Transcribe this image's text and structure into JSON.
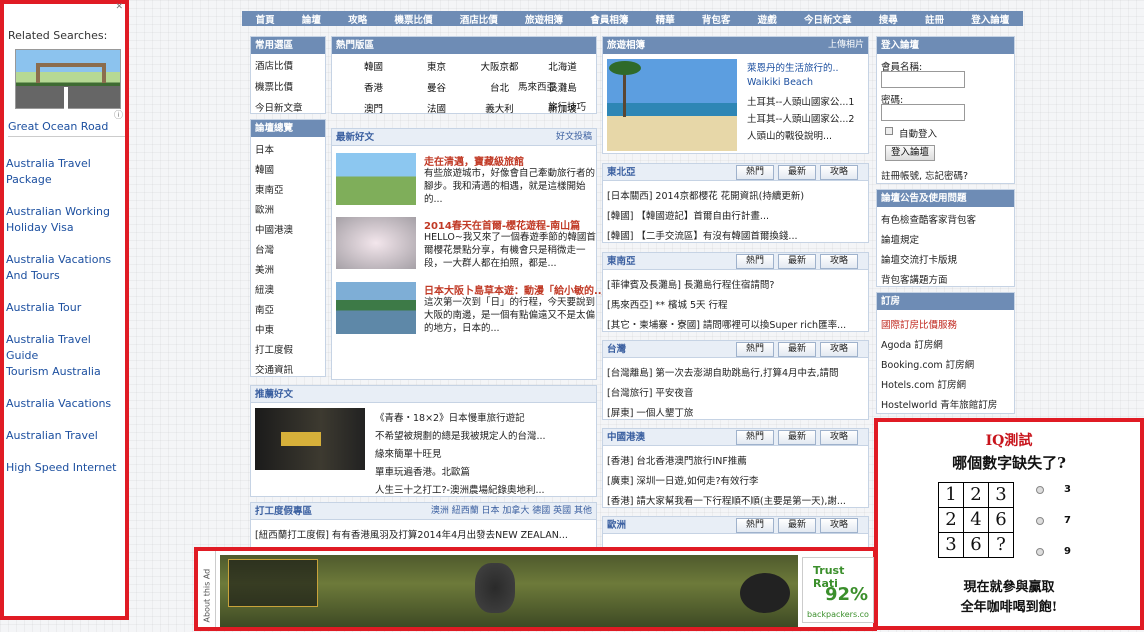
{
  "sidebar": {
    "related": "Related Searches:",
    "caption": "Great Ocean Road",
    "links": [
      "Australia Travel Package",
      "Australian Working Holiday Visa",
      "Australia Vacations And Tours",
      "Australia Tour",
      "Australia Travel Guide",
      "Tourism Australia",
      "Australia Vacations",
      "Australian Travel",
      "High Speed Internet"
    ]
  },
  "nav": [
    "首頁",
    "論壇",
    "攻略",
    "機票比價",
    "酒店比價",
    "旅遊相簿",
    "會員相簿",
    "精華",
    "背包客",
    "遊戲",
    "今日新文章",
    "搜尋",
    "註冊",
    "登入論壇"
  ],
  "common": {
    "title": "常用選區",
    "items": [
      "酒店比價",
      "機票比價",
      "今日新文章"
    ]
  },
  "hot": {
    "title": "熱門版區",
    "items": [
      "韓國",
      "東京",
      "大阪京都",
      "北海道",
      "香港",
      "曼谷",
      "台北",
      "長灘島",
      "澳門",
      "法國",
      "義大利",
      "新加坡",
      "馬來西亞",
      "旅行技巧"
    ]
  },
  "album": {
    "title": "旅遊相簿",
    "more": "上傳相片",
    "caption": "Waikiki Beach",
    "items": [
      "萊恩丹的生活旅行的..",
      "土耳其--人頭山國家公...1",
      "土耳其--人頭山國家公...2",
      "人頭山的戰役說明..."
    ]
  },
  "login": {
    "title": "登入論壇",
    "user_label": "會員名稱:",
    "pass_label": "密碼:",
    "remember": "自動登入",
    "button": "登入論壇",
    "forgot": "註冊帳號, 忘記密碼?"
  },
  "forum": {
    "title": "論壇總覽",
    "items": [
      "日本",
      "韓國",
      "東南亞",
      "歐洲",
      "中國港澳",
      "台灣",
      "美洲",
      "紐澳",
      "南亞",
      "中東",
      "打工度假",
      "旅遊技巧",
      "交通資訊",
      "更多論壇"
    ]
  },
  "latest": {
    "title": "最新好文",
    "more": "好文投稿",
    "articles": [
      {
        "title": "走在清邁，寶藏級旅館",
        "body": "有些旅遊城市，好像會自己牽動旅行者的腳步。我和清邁的相遇，就是這樣開始的..."
      },
      {
        "title": "2014春天在首爾-櫻花遊程-南山篇",
        "body": "HELLO~我又來了一個春遊季節的韓國首爾櫻花景點分享，有機會只是稍微走一段，一大群人都在拍照，都是..."
      },
      {
        "title": "日本大阪卜島草本遊：動漫「給小敏的..」",
        "body": "這次第一次到「日」的行程，今天要說到大阪的南邊，是一個有點偏遠又不是太偏的地方，日本的..."
      }
    ]
  },
  "recommend": {
    "title": "推薦好文",
    "items": [
      "《青春・18×2》日本慢車旅行遊記",
      "不希望被規劃的總是我被規定人的台灣...",
      "緣來簡單十旺見",
      "單車玩遍香港。北歐篇",
      "人生三十之打工?-澳洲農場紀錄奧地利..."
    ]
  },
  "work": {
    "title": "打工度假專區",
    "regions": "澳洲 紐西蘭 日本 加拿大 德國 英國 其他",
    "item": "[紐西蘭打工度假] 有有香港風羽及打算2014年4月出發去NEW ZEALAN..."
  },
  "tabs": [
    "熱門",
    "最新",
    "攻略"
  ],
  "regions": [
    {
      "title": "東北亞",
      "items": [
        "[日本關西] 2014京都櫻花 花開資訊(持續更新)",
        "[韓國] 【韓國遊記】首爾自由行計畫...",
        "[韓國] 【二手交流區】有沒有韓國首爾換錢..."
      ]
    },
    {
      "title": "東南亞",
      "items": [
        "[菲律賓及長灘島] 長灘島行程住宿請問?",
        "[馬來西亞] ** 檳城 5天 行程",
        "[其它・柬埔寨・寮國] 請問哪裡可以換Super rich匯率..."
      ]
    },
    {
      "title": "台灣",
      "items": [
        "[台灣離島] 第一次去澎湖自助跳島行,打算4月中去,請問",
        "[台灣旅行] 平安夜音",
        "[屏東] 一個人墾丁旅"
      ]
    },
    {
      "title": "中國港澳",
      "items": [
        "[香港] 台北香港澳門旅行INF推薦",
        "[廣東] 深圳一日遊,如何走?有效行李",
        "[香港] 請大家幫我看一下行程順不順(主要是第一天),謝..."
      ]
    },
    {
      "title": "歐洲",
      "items": [
        "[中歐東歐其他] 歐洲行程...找同伴..."
      ]
    }
  ],
  "news": {
    "title": "論壇公告及使用問題",
    "items": [
      "有色檢查酷客家背包客",
      "論壇規定",
      "論壇交流打卡版規",
      "背包客講題方面"
    ]
  },
  "hotel": {
    "title": "訂房",
    "items": [
      "國際訂房比價服務",
      "Agoda 訂房網",
      "Booking.com 訂房網",
      "Hotels.com 訂房網",
      "Hostelworld 青年旅館訂房"
    ]
  },
  "ad": {
    "side_text": "About this Ad",
    "trust": "Trust Rati",
    "percent": "92%",
    "site": "backpackers.co"
  },
  "iq": {
    "title": "IQ測試",
    "question": "哪個數字缺失了?",
    "grid": [
      "1",
      "2",
      "3",
      "2",
      "4",
      "6",
      "3",
      "6",
      "?"
    ],
    "options": [
      "3",
      "7",
      "9"
    ],
    "footer1": "現在就參與贏取",
    "footer2": "全年咖啡喝到飽!"
  }
}
